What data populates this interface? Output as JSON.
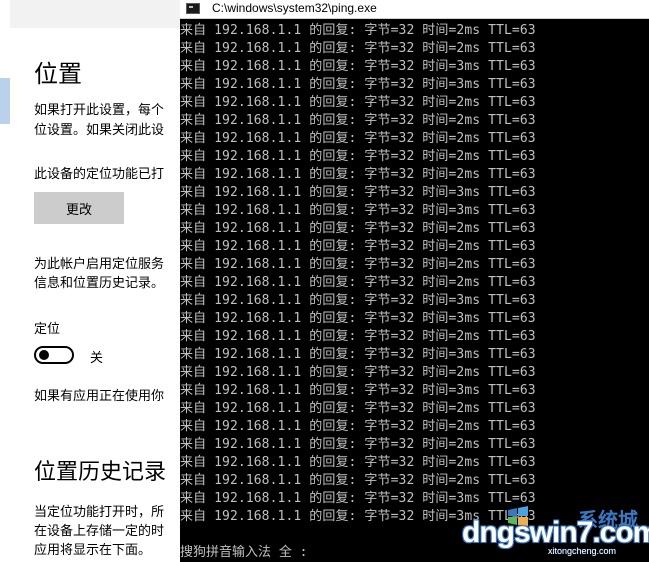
{
  "settings": {
    "title": "位置",
    "desc_line1": "如果打开此设置，每个",
    "desc_line2": "位设置。如果关闭此设",
    "device_status": "此设备的定位功能已打",
    "change_button": "更改",
    "account_line1": "为此帐户启用定位服务",
    "account_line2": "信息和位置历史记录。",
    "location_label": "定位",
    "toggle_state": "关",
    "apps_using": "如果有应用正在使用你",
    "history_title": "位置历史记录",
    "history_line1": "当定位功能打开时，所",
    "history_line2": "在设备上存储一定的时",
    "history_line3": "应用将显示在下面。"
  },
  "console": {
    "window_title": "C:\\windows\\system32\\ping.exe",
    "lines": [
      "来自 192.168.1.1 的回复: 字节=32 时间=2ms TTL=63",
      "来自 192.168.1.1 的回复: 字节=32 时间=2ms TTL=63",
      "来自 192.168.1.1 的回复: 字节=32 时间=3ms TTL=63",
      "来自 192.168.1.1 的回复: 字节=32 时间=3ms TTL=63",
      "来自 192.168.1.1 的回复: 字节=32 时间=2ms TTL=63",
      "来自 192.168.1.1 的回复: 字节=32 时间=2ms TTL=63",
      "来自 192.168.1.1 的回复: 字节=32 时间=2ms TTL=63",
      "来自 192.168.1.1 的回复: 字节=32 时间=2ms TTL=63",
      "来自 192.168.1.1 的回复: 字节=32 时间=2ms TTL=63",
      "来自 192.168.1.1 的回复: 字节=32 时间=3ms TTL=63",
      "来自 192.168.1.1 的回复: 字节=32 时间=3ms TTL=63",
      "来自 192.168.1.1 的回复: 字节=32 时间=2ms TTL=63",
      "来自 192.168.1.1 的回复: 字节=32 时间=2ms TTL=63",
      "来自 192.168.1.1 的回复: 字节=32 时间=2ms TTL=63",
      "来自 192.168.1.1 的回复: 字节=32 时间=2ms TTL=63",
      "来自 192.168.1.1 的回复: 字节=32 时间=3ms TTL=63",
      "来自 192.168.1.1 的回复: 字节=32 时间=3ms TTL=63",
      "来自 192.168.1.1 的回复: 字节=32 时间=2ms TTL=63",
      "来自 192.168.1.1 的回复: 字节=32 时间=3ms TTL=63",
      "来自 192.168.1.1 的回复: 字节=32 时间=2ms TTL=63",
      "来自 192.168.1.1 的回复: 字节=32 时间=3ms TTL=63",
      "来自 192.168.1.1 的回复: 字节=32 时间=2ms TTL=63",
      "来自 192.168.1.1 的回复: 字节=32 时间=2ms TTL=63",
      "来自 192.168.1.1 的回复: 字节=32 时间=2ms TTL=63",
      "来自 192.168.1.1 的回复: 字节=32 时间=2ms TTL=63",
      "来自 192.168.1.1 的回复: 字节=32 时间=2ms TTL=63",
      "来自 192.168.1.1 的回复: 字节=32 时间=3ms TTL=63",
      "来自 192.168.1.1 的回复: 字节=32 时间=3ms TTL=63"
    ],
    "ime_status": "搜狗拼音输入法 全 :"
  },
  "watermark": {
    "main": "dngswin7.com",
    "cn": "系统城",
    "sub": "xitongcheng.com"
  }
}
